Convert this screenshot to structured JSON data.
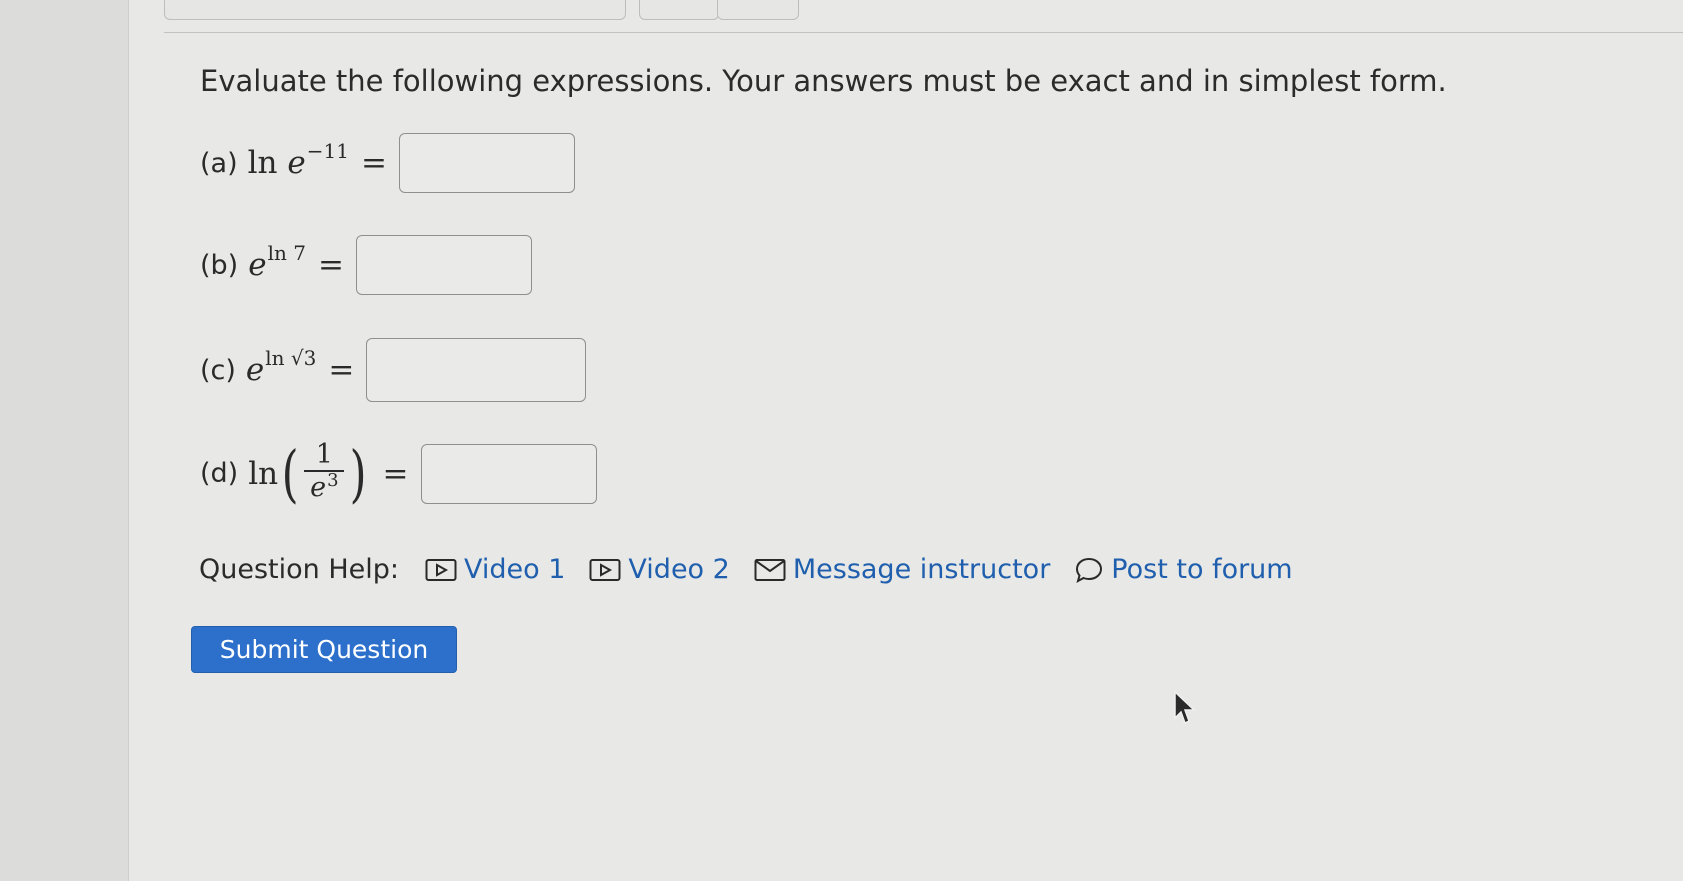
{
  "instructions": "Evaluate the following expressions. Your answers must be exact and in simplest form.",
  "parts": [
    {
      "label": "(a)",
      "func": "ln",
      "base": "e",
      "exponent": "−11",
      "equals": "=",
      "answer": ""
    },
    {
      "label": "(b)",
      "base": "e",
      "exponent": "ln 7",
      "equals": "=",
      "answer": ""
    },
    {
      "label": "(c)",
      "base": "e",
      "exponent": "ln √3",
      "equals": "=",
      "answer": ""
    },
    {
      "label": "(d)",
      "func": "ln",
      "numerator": "1",
      "denominator_base": "e",
      "denominator_exponent": "3",
      "equals": "=",
      "answer": ""
    }
  ],
  "help": {
    "label": "Question Help:",
    "video1": "Video 1",
    "video2": "Video 2",
    "message": "Message instructor",
    "forum": "Post to forum"
  },
  "submit_label": "Submit Question",
  "colors": {
    "link": "#1f5fae",
    "button": "#2c70cc",
    "background": "#e8e8e6"
  }
}
